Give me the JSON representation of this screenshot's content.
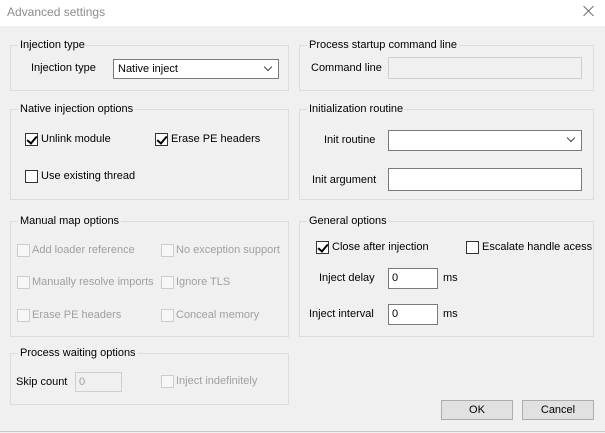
{
  "window": {
    "title": "Advanced settings"
  },
  "injection_type": {
    "legend": "Injection type",
    "label": "Injection type",
    "value": "Native inject"
  },
  "native_injection": {
    "legend": "Native injection options",
    "unlink_module": {
      "label": "Unlink module",
      "checked": true
    },
    "erase_pe_headers": {
      "label": "Erase PE headers",
      "checked": true
    },
    "use_existing_thread": {
      "label": "Use existing thread",
      "checked": false
    }
  },
  "manual_map": {
    "legend": "Manual map options",
    "add_loader_reference": "Add loader reference",
    "no_exception_support": "No exception support",
    "manually_resolve_imports": "Manually resolve imports",
    "ignore_tls": "Ignore TLS",
    "erase_pe_headers": "Erase PE headers",
    "conceal_memory": "Conceal memory"
  },
  "process_waiting": {
    "legend": "Process waiting options",
    "skip_count_label": "Skip count",
    "skip_count_value": "0",
    "inject_indefinitely": "Inject indefinitely"
  },
  "startup_cmd": {
    "legend": "Process startup command line",
    "label": "Command line",
    "value": ""
  },
  "init_routine": {
    "legend": "Initialization routine",
    "routine_label": "Init routine",
    "routine_value": "",
    "argument_label": "Init argument",
    "argument_value": ""
  },
  "general": {
    "legend": "General options",
    "close_after_injection": {
      "label": "Close after injection",
      "checked": true
    },
    "escalate_handle_access": {
      "label": "Escalate handle acess",
      "checked": false
    },
    "inject_delay_label": "Inject delay",
    "inject_delay_value": "0",
    "inject_delay_unit": "ms",
    "inject_interval_label": "Inject interval",
    "inject_interval_value": "0",
    "inject_interval_unit": "ms"
  },
  "buttons": {
    "ok": "OK",
    "cancel": "Cancel"
  }
}
